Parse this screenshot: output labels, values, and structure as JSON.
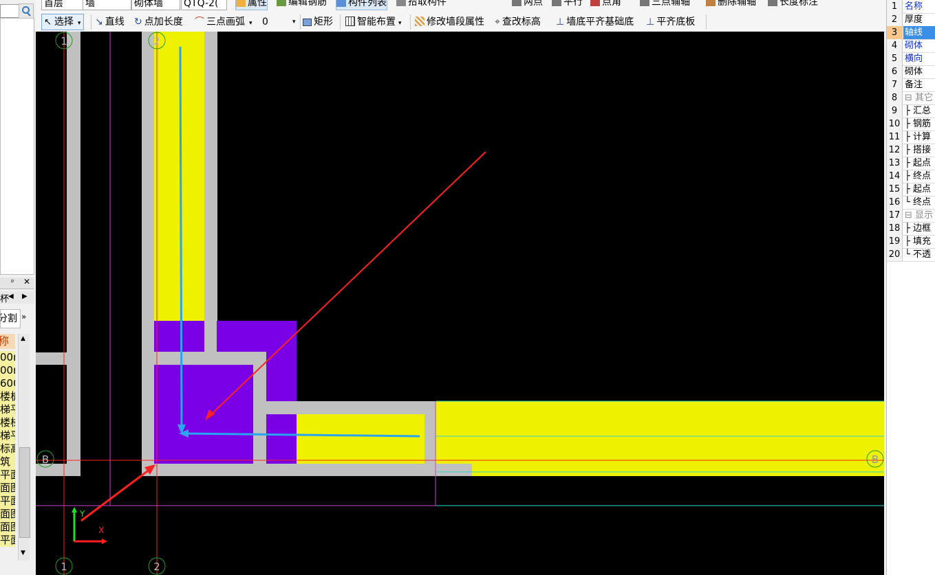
{
  "toolbar_top": {
    "floor": "首层",
    "type": "墙",
    "subtype": "砌体墙",
    "component": "QTQ-2(",
    "attr_btn": "属性",
    "edit_rebar": "编辑钢筋",
    "component_list": "构件列表",
    "pick_component": "拾取构件",
    "two_points": "两点",
    "parallel": "平行",
    "point_angle": "点角",
    "three_point_aux": "三点辅轴",
    "delete_aux": "删除辅轴",
    "length_mark": "长度标注"
  },
  "toolbar_main": {
    "select": "选择",
    "line": "直线",
    "point_length": "点加长度",
    "three_point_arc": "三点画弧",
    "arc_value": "0",
    "rect": "矩形",
    "smart_layout": "智能布置",
    "modify_wall_attr": "修改墙段属性",
    "check_elevation": "查改标高",
    "wall_bottom_align": "墙底平齐基础底",
    "flush_bottom": "平齐底板"
  },
  "left_panel": {
    "split_label": "分割",
    "name_header": "称",
    "list": [
      "00n",
      "00n",
      "600",
      "楼板",
      "梯平",
      "楼梯",
      "梯平",
      "标高",
      "筑",
      "平面",
      "面图",
      "平面",
      "面图",
      "面图",
      "平面"
    ]
  },
  "canvas": {
    "axis_labels": {
      "ax1_top": "1",
      "ax2_top": "2",
      "ax1_bottom": "1",
      "ax2_bottom": "2",
      "axB_left": "B",
      "axB_right": "B"
    },
    "ucs": {
      "x": "X",
      "y": "Y"
    },
    "colors": {
      "wall_fill": "#eef200",
      "column_fill": "#7a00e6",
      "wall_border": "#c0c0c0",
      "axis": "#ff2020",
      "annotation": "#ff2020",
      "blue_arrow": "#2aa4f0"
    }
  },
  "right_panel": {
    "rows": [
      {
        "n": "1",
        "t": "名称",
        "blue": true
      },
      {
        "n": "2",
        "t": "厚度"
      },
      {
        "n": "3",
        "t": "轴线",
        "sel": true
      },
      {
        "n": "4",
        "t": "砌体",
        "blue": true
      },
      {
        "n": "5",
        "t": "横向",
        "blue": true
      },
      {
        "n": "6",
        "t": "砌体"
      },
      {
        "n": "7",
        "t": "备注"
      },
      {
        "n": "8",
        "t": "⊟ 其它",
        "grey": true
      },
      {
        "n": "9",
        "t": "├ 汇总"
      },
      {
        "n": "10",
        "t": "├ 钢筋"
      },
      {
        "n": "11",
        "t": "├ 计算"
      },
      {
        "n": "12",
        "t": "├ 搭接"
      },
      {
        "n": "13",
        "t": "├ 起点"
      },
      {
        "n": "14",
        "t": "├ 终点"
      },
      {
        "n": "15",
        "t": "├ 起点"
      },
      {
        "n": "16",
        "t": "└ 终点"
      },
      {
        "n": "17",
        "t": "⊟ 显示",
        "grey": true
      },
      {
        "n": "18",
        "t": "├ 边框"
      },
      {
        "n": "19",
        "t": "├ 填充"
      },
      {
        "n": "20",
        "t": "└ 不透"
      }
    ]
  }
}
